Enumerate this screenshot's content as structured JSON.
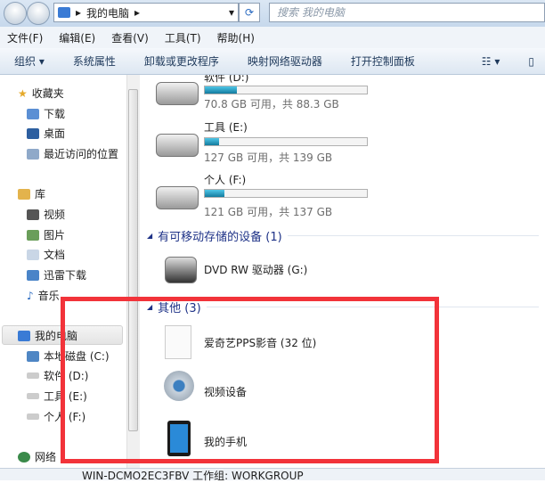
{
  "address": {
    "path": "我的电脑",
    "search_placeholder": "搜索 我的电脑"
  },
  "menu": [
    "文件(F)",
    "编辑(E)",
    "查看(V)",
    "工具(T)",
    "帮助(H)"
  ],
  "toolbar": [
    "组织 ▾",
    "系统属性",
    "卸载或更改程序",
    "映射网络驱动器",
    "打开控制面板"
  ],
  "sidebar": {
    "favorites": "收藏夹",
    "fav_items": [
      "下载",
      "桌面",
      "最近访问的位置"
    ],
    "libraries": "库",
    "lib_items": [
      "视频",
      "图片",
      "文档",
      "迅雷下载",
      "音乐"
    ],
    "computer": "我的电脑",
    "comp_items": [
      "本地磁盘 (C:)",
      "软件 (D:)",
      "工具 (E:)",
      "个人 (F:)"
    ],
    "network": "网络"
  },
  "drives": [
    {
      "label": "软件 (D:)",
      "free": "70.8 GB 可用，共 88.3 GB",
      "used_percent": 20
    },
    {
      "label": "工具 (E:)",
      "free": "127 GB 可用，共 139 GB",
      "used_percent": 9
    },
    {
      "label": "个人 (F:)",
      "free": "121 GB 可用，共 137 GB",
      "used_percent": 12
    }
  ],
  "removable": {
    "header": "有可移动存储的设备 (1)",
    "items": [
      "DVD RW 驱动器 (G:)"
    ]
  },
  "other": {
    "header": "其他 (3)",
    "items": [
      "爱奇艺PPS影音 (32 位)",
      "视频设备",
      "我的手机"
    ]
  },
  "status": "WIN-DCMO2EC3FBV  工作组: WORKGROUP",
  "colors": {
    "highlight": "#f2333a",
    "bar_fill": "#26a0c8"
  }
}
